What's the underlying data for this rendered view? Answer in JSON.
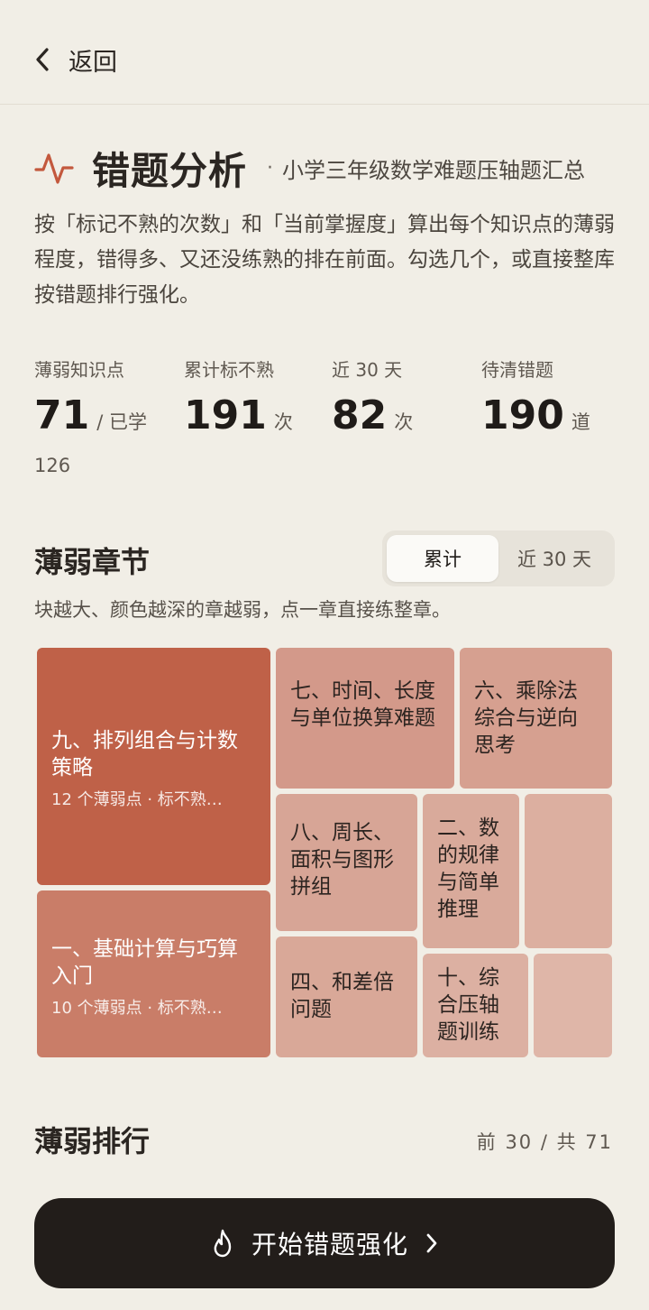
{
  "nav": {
    "back_label": "返回"
  },
  "header": {
    "title": "错题分析",
    "separator": "·",
    "subtitle": "小学三年级数学难题压轴题汇总",
    "description": "按「标记不熟的次数」和「当前掌握度」算出每个知识点的薄弱程度，错得多、又还没练熟的排在前面。勾选几个，或直接整库按错题排行强化。"
  },
  "stats": [
    {
      "label": "薄弱知识点",
      "value": "71",
      "unit": "/ 已学",
      "extra": "126"
    },
    {
      "label": "累计标不熟",
      "value": "191",
      "unit": "次"
    },
    {
      "label": "近 30 天",
      "value": "82",
      "unit": "次"
    },
    {
      "label": "待清错题",
      "value": "190",
      "unit": "道"
    }
  ],
  "weak_chapters": {
    "title": "薄弱章节",
    "toggle": {
      "options": [
        "累计",
        "近 30 天"
      ],
      "selected": "累计"
    },
    "hint": "块越大、颜色越深的章越弱，点一章直接练整章。",
    "tiles": [
      {
        "name": "九、排列组合与计数策略",
        "meta": "12 个薄弱点 · 标不熟…",
        "color": "#bf6148"
      },
      {
        "name": "一、基础计算与巧算入门",
        "meta": "10 个薄弱点 · 标不熟…",
        "color": "#c97d68"
      },
      {
        "name": "七、时间、长度与单位换算难题",
        "meta": "",
        "color": "#d3998a"
      },
      {
        "name": "六、乘除法综合与逆向思考",
        "meta": "",
        "color": "#d6a090"
      },
      {
        "name": "八、周长、面积与图形拼组",
        "meta": "",
        "color": "#d7a596"
      },
      {
        "name": "二、数的规律与简单推理",
        "meta": "",
        "color": "#d9aa9b"
      },
      {
        "name": "",
        "meta": "",
        "color": "#dcafa0"
      },
      {
        "name": "四、和差倍问题",
        "meta": "",
        "color": "#d9a898"
      },
      {
        "name": "十、综合压轴题训练",
        "meta": "",
        "color": "#dcb0a2"
      },
      {
        "name": "",
        "meta": "",
        "color": "#dfb6a8"
      }
    ]
  },
  "ranking": {
    "title": "薄弱排行",
    "meta": "前 30 / 共 71"
  },
  "cta": {
    "label": "开始错题强化"
  }
}
